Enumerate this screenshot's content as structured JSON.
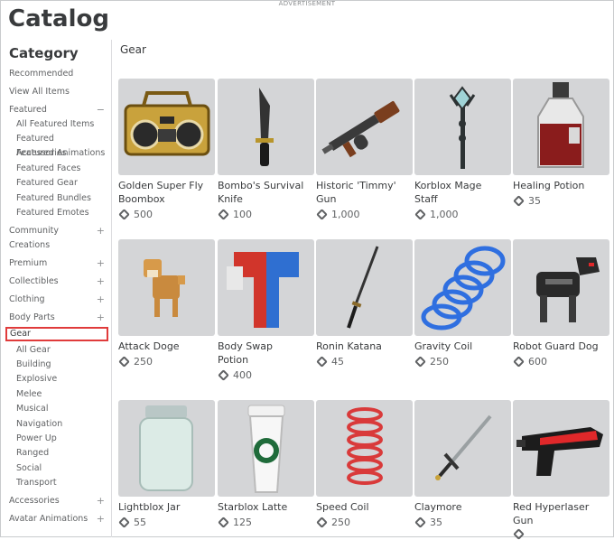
{
  "advertisement": "ADVERTISEMENT",
  "page_title": "Catalog",
  "sidebar": {
    "heading": "Category",
    "items": [
      {
        "label": "Recommended",
        "sub": false,
        "sign": ""
      },
      {
        "label": "View All Items",
        "sub": false,
        "sign": ""
      },
      {
        "label": "Featured",
        "sub": false,
        "sign": "−"
      },
      {
        "label": "All Featured Items",
        "sub": true,
        "sign": ""
      },
      {
        "label": "Featured Accessories",
        "sub": true,
        "sign": ""
      },
      {
        "label": "Featured Animations",
        "sub": true,
        "sign": ""
      },
      {
        "label": "Featured Faces",
        "sub": true,
        "sign": ""
      },
      {
        "label": "Featured Gear",
        "sub": true,
        "sign": ""
      },
      {
        "label": "Featured Bundles",
        "sub": true,
        "sign": ""
      },
      {
        "label": "Featured Emotes",
        "sub": true,
        "sign": ""
      },
      {
        "label": "Community",
        "sub": false,
        "sign": "+"
      },
      {
        "label": "Creations",
        "sub": false,
        "sign": ""
      },
      {
        "label": "Premium",
        "sub": false,
        "sign": "+"
      },
      {
        "label": "Collectibles",
        "sub": false,
        "sign": "+"
      },
      {
        "label": "Clothing",
        "sub": false,
        "sign": "+"
      },
      {
        "label": "Body Parts",
        "sub": false,
        "sign": "+"
      },
      {
        "label": "Gear",
        "sub": false,
        "sign": "",
        "selected": true
      },
      {
        "label": "All Gear",
        "sub": true,
        "sign": ""
      },
      {
        "label": "Building",
        "sub": true,
        "sign": ""
      },
      {
        "label": "Explosive",
        "sub": true,
        "sign": ""
      },
      {
        "label": "Melee",
        "sub": true,
        "sign": ""
      },
      {
        "label": "Musical",
        "sub": true,
        "sign": ""
      },
      {
        "label": "Navigation",
        "sub": true,
        "sign": ""
      },
      {
        "label": "Power Up",
        "sub": true,
        "sign": ""
      },
      {
        "label": "Ranged",
        "sub": true,
        "sign": ""
      },
      {
        "label": "Social",
        "sub": true,
        "sign": ""
      },
      {
        "label": "Transport",
        "sub": true,
        "sign": ""
      },
      {
        "label": "Accessories",
        "sub": false,
        "sign": "+"
      },
      {
        "label": "Avatar Animations",
        "sub": false,
        "sign": "+"
      }
    ]
  },
  "main": {
    "heading": "Gear",
    "items": [
      {
        "name1": "Golden Super Fly",
        "name2": "Boombox",
        "price": "500",
        "icon": "boombox"
      },
      {
        "name1": "Bombo's Survival",
        "name2": "Knife",
        "price": "100",
        "icon": "knife"
      },
      {
        "name1": "Historic 'Timmy'",
        "name2": "Gun",
        "price": "1,000",
        "icon": "tommy-gun"
      },
      {
        "name1": "Korblox Mage",
        "name2": "Staff",
        "price": "1,000",
        "icon": "staff"
      },
      {
        "name1": "Healing Potion",
        "name2": "",
        "price": "35",
        "icon": "potion"
      },
      {
        "name1": "Attack Doge",
        "name2": "",
        "price": "250",
        "icon": "doge"
      },
      {
        "name1": "Body Swap",
        "name2": "Potion",
        "price": "400",
        "icon": "body-swap"
      },
      {
        "name1": "Ronin Katana",
        "name2": "",
        "price": "45",
        "icon": "katana"
      },
      {
        "name1": "Gravity Coil",
        "name2": "",
        "price": "250",
        "icon": "blue-coil"
      },
      {
        "name1": "Robot Guard Dog",
        "name2": "",
        "price": "600",
        "icon": "robot-dog"
      },
      {
        "name1": "Lightblox Jar",
        "name2": "",
        "price": "55",
        "icon": "jar"
      },
      {
        "name1": "Starblox Latte",
        "name2": "",
        "price": "125",
        "icon": "latte"
      },
      {
        "name1": "Speed Coil",
        "name2": "",
        "price": "250",
        "icon": "red-coil"
      },
      {
        "name1": "Claymore",
        "name2": "",
        "price": "35",
        "icon": "claymore"
      },
      {
        "name1": "Red Hyperlaser",
        "name2": "Gun",
        "price": "",
        "icon": "laser-gun"
      }
    ]
  }
}
